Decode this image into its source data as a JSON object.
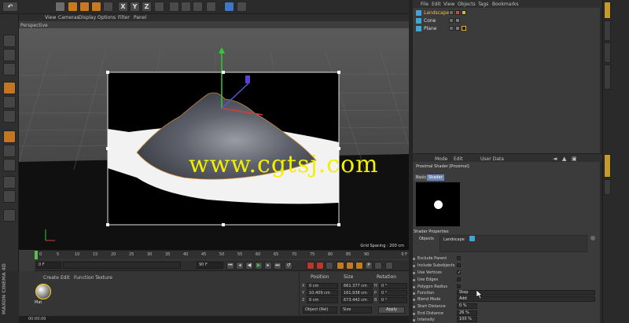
{
  "toolbar": {
    "undo_icon": "undo-icon",
    "axis_letters": [
      "X",
      "Y",
      "Z"
    ]
  },
  "viewport": {
    "menu": [
      "View",
      "Cameras",
      "Display",
      "Options",
      "Filter",
      "Panel"
    ],
    "title": "Perspective",
    "grid_spacing": "Grid Spacing : 200 cm",
    "watermark": "www.cgtsj.com"
  },
  "timeline": {
    "ticks": [
      "0",
      "5",
      "10",
      "15",
      "20",
      "25",
      "30",
      "35",
      "40",
      "45",
      "50",
      "55",
      "60",
      "65",
      "70",
      "75",
      "80",
      "85",
      "90"
    ],
    "frame_display": "0 F",
    "start_frame": "0 F",
    "end_frame": "90 F",
    "current_frame": "0 F"
  },
  "material_manager": {
    "menu": [
      "Create",
      "Edit",
      "Function",
      "Texture"
    ],
    "material_name": "Mat",
    "logo": "MAXON CINEMA 4D",
    "status_time": "00:00:00"
  },
  "coordinates": {
    "headers": [
      "Position",
      "Size",
      "Rotation"
    ],
    "rows": [
      {
        "axis": "X",
        "pos": "0 cm",
        "size": "661.377 cm",
        "rot_axis": "H",
        "rot": "0 °"
      },
      {
        "axis": "Y",
        "pos": "10.409 cm",
        "size": "161.938 cm",
        "rot_axis": "P",
        "rot": "0 °"
      },
      {
        "axis": "Z",
        "pos": "0 cm",
        "size": "673.442 cm",
        "rot_axis": "B",
        "rot": "0 °"
      }
    ],
    "mode_dropdown": "Object (Rel)",
    "size_dropdown": "Size",
    "apply_label": "Apply"
  },
  "object_manager": {
    "menu": [
      "File",
      "Edit",
      "View",
      "Objects",
      "Tags",
      "Bookmarks"
    ],
    "objects": [
      {
        "name": "Landscape",
        "selected": true
      },
      {
        "name": "Cone",
        "selected": false
      },
      {
        "name": "Plane",
        "selected": false
      }
    ]
  },
  "attribute_manager": {
    "header_items": [
      "Mode",
      "Edit",
      "User Data"
    ],
    "shader_title": "Proximal Shader [Proximal]",
    "tabs": [
      "Basic",
      "Shader"
    ],
    "section": "Shader Properties",
    "objects_label": "Objects",
    "objects_value": "Landscape",
    "properties": [
      {
        "label": "Exclude Parent",
        "type": "check",
        "value": ""
      },
      {
        "label": "Include Subobjects",
        "type": "check",
        "value": ""
      },
      {
        "label": "Use Vertices",
        "type": "check",
        "value": "✓"
      },
      {
        "label": "Use Edges",
        "type": "check",
        "value": ""
      },
      {
        "label": "Polygon Radius",
        "type": "check",
        "value": ""
      },
      {
        "label": "Function",
        "type": "field",
        "value": "Step"
      },
      {
        "label": "Blend Mode",
        "type": "field",
        "value": "Add"
      },
      {
        "label": "Start Distance",
        "type": "field",
        "value": "0 %"
      },
      {
        "label": "End Distance",
        "type": "field",
        "value": "26 %"
      },
      {
        "label": "Intensity",
        "type": "field",
        "value": "100 %"
      }
    ]
  },
  "colors": {
    "selected_object": "#f0c040",
    "accent_orange": "#c87a1e",
    "watermark": "#f2f000",
    "active_tab": "#6a86b4"
  }
}
